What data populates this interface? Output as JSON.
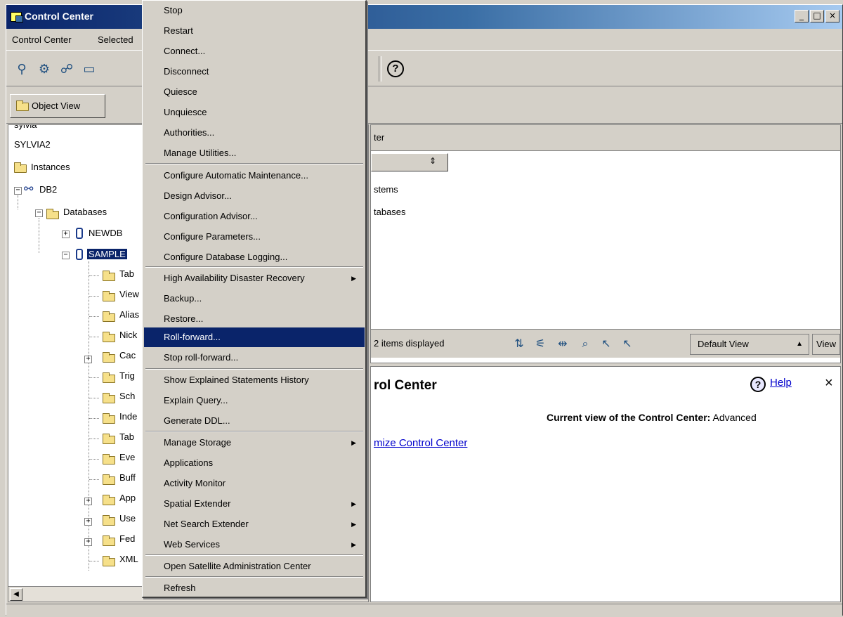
{
  "window": {
    "title": "Control Center",
    "controls": [
      "_",
      "□",
      "×"
    ]
  },
  "menubar": {
    "items": [
      "Control Center",
      "Selected"
    ]
  },
  "toolbar": {
    "icons": [
      "tree-icon",
      "launch-icon",
      "connect-icon",
      "command-icon",
      "help-icon"
    ]
  },
  "viewbar": {
    "object_view_label": "Object View"
  },
  "tree": {
    "nodes": [
      {
        "label": "sylvia",
        "type": "system"
      },
      {
        "label": "SYLVIA2",
        "type": "system"
      },
      {
        "label": "Instances",
        "type": "folder"
      },
      {
        "label": "DB2",
        "type": "instance"
      },
      {
        "label": "Databases",
        "type": "folder"
      },
      {
        "label": "NEWDB",
        "type": "database"
      },
      {
        "label": "SAMPLE",
        "type": "database",
        "selected": true
      },
      {
        "label": "Tab",
        "type": "folder"
      },
      {
        "label": "View",
        "type": "folder"
      },
      {
        "label": "Alias",
        "type": "folder"
      },
      {
        "label": "Nick",
        "type": "folder"
      },
      {
        "label": "Cac",
        "type": "folder"
      },
      {
        "label": "Trig",
        "type": "folder"
      },
      {
        "label": "Sch",
        "type": "folder"
      },
      {
        "label": "Inde",
        "type": "folder"
      },
      {
        "label": "Tab",
        "type": "folder"
      },
      {
        "label": "Eve",
        "type": "folder"
      },
      {
        "label": "Buff",
        "type": "folder"
      },
      {
        "label": "App",
        "type": "folder"
      },
      {
        "label": "Use",
        "type": "folder"
      },
      {
        "label": "Fed",
        "type": "folder"
      },
      {
        "label": "XML",
        "type": "folder"
      }
    ]
  },
  "contents": {
    "title": "ter",
    "column_sort": "⇕",
    "rows": [
      "stems",
      "tabases"
    ],
    "items_displayed": "2 items displayed",
    "default_view": "Default View",
    "view_button": "View"
  },
  "info": {
    "title": "rol Center",
    "help_label": "Help",
    "close": "×",
    "current_view_label": "Current view of the Control Center:",
    "current_view_value": "Advanced",
    "customize_link": "mize Control Center"
  },
  "context_menu": {
    "items": [
      {
        "label": "Stop"
      },
      {
        "label": "Restart"
      },
      {
        "label": "Connect..."
      },
      {
        "label": "Disconnect"
      },
      {
        "label": "Quiesce"
      },
      {
        "label": "Unquiesce"
      },
      {
        "label": "Authorities..."
      },
      {
        "label": "Manage Utilities..."
      },
      {
        "label": "Configure Automatic Maintenance..."
      },
      {
        "label": "Design Advisor..."
      },
      {
        "label": "Configuration Advisor..."
      },
      {
        "label": "Configure Parameters..."
      },
      {
        "label": "Configure Database Logging..."
      },
      {
        "label": "High Availability Disaster Recovery",
        "submenu": true
      },
      {
        "label": "Backup..."
      },
      {
        "label": "Restore..."
      },
      {
        "label": "Roll-forward...",
        "selected": true
      },
      {
        "label": "Stop roll-forward..."
      },
      {
        "label": "Show Explained Statements History"
      },
      {
        "label": "Explain Query..."
      },
      {
        "label": "Generate DDL..."
      },
      {
        "label": "Manage Storage",
        "submenu": true
      },
      {
        "label": "Applications"
      },
      {
        "label": "Activity Monitor"
      },
      {
        "label": "Spatial Extender",
        "submenu": true
      },
      {
        "label": "Net Search Extender",
        "submenu": true
      },
      {
        "label": "Web Services",
        "submenu": true
      },
      {
        "label": "Open Satellite Administration Center"
      },
      {
        "label": "Refresh"
      }
    ]
  },
  "colors": {
    "selection": "#0a246a",
    "face": "#d4d0c8",
    "link": "#0000cc"
  }
}
